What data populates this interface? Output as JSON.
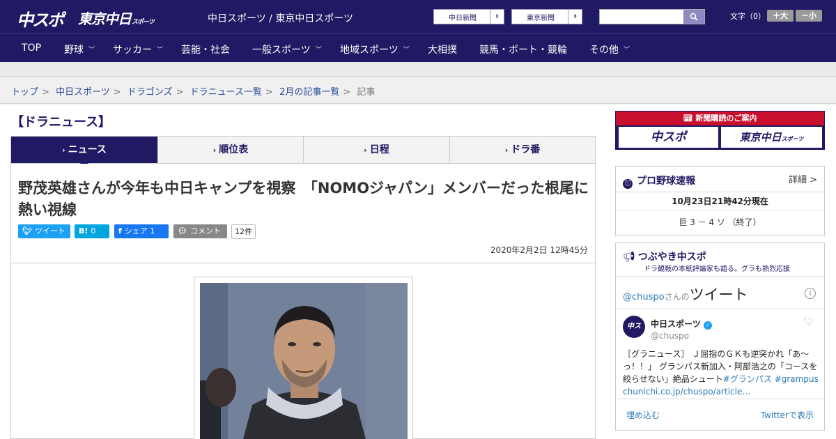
{
  "header": {
    "logo_chuspo": "中スポ",
    "logo_tokyo": "東京中日",
    "logo_tokyo_sub": "スポーツ",
    "site_links": "中日スポーツ / 東京中日スポーツ",
    "paper_buttons": [
      {
        "label": "中日新聞"
      },
      {
        "label": "東京新聞"
      }
    ],
    "search_placeholder": "",
    "font_size_label": "文字（0）",
    "font_bigger": "＋大",
    "font_smaller": "－小"
  },
  "nav": {
    "items": [
      {
        "label": "TOP",
        "dropdown": false
      },
      {
        "label": "野球",
        "dropdown": true
      },
      {
        "label": "サッカー",
        "dropdown": true
      },
      {
        "label": "芸能・社会",
        "dropdown": false
      },
      {
        "label": "一般スポーツ",
        "dropdown": true
      },
      {
        "label": "地域スポーツ",
        "dropdown": true
      },
      {
        "label": "大相撲",
        "dropdown": false
      },
      {
        "label": "競馬・ボート・競輪",
        "dropdown": false
      },
      {
        "label": "その他",
        "dropdown": true
      }
    ]
  },
  "breadcrumb": {
    "items": [
      "トップ",
      "中日スポーツ",
      "ドラゴンズ",
      "ドラニュース一覧",
      "2月の記事一覧"
    ],
    "current": "記事",
    "separator": ">"
  },
  "section_title": "【ドラニュース】",
  "tabs": [
    {
      "label": "ニュース",
      "active": true
    },
    {
      "label": "順位表",
      "active": false
    },
    {
      "label": "日程",
      "active": false
    },
    {
      "label": "ドラ番",
      "active": false
    }
  ],
  "article": {
    "title": "野茂英雄さんが今年も中日キャンプを視察　「NOMOジャパン」メンバーだった根尾に熱い視線",
    "share": {
      "tweet": "ツイート",
      "hatena_icon": "B!",
      "hatena_count": "0",
      "fb_share": "シェア",
      "fb_count": "1",
      "comment": "コメント",
      "comment_count": "12件"
    },
    "date": "2020年2月2日 12時45分"
  },
  "sidebar": {
    "ad": {
      "header": "新聞購読のご案内",
      "chuspo": "中スポ",
      "tokyo": "東京中日",
      "tokyo_sub": "スポーツ"
    },
    "baseball": {
      "title": "プロ野球速報",
      "more": "詳細 >",
      "updated": "10月23日21時42分現在",
      "score": "巨 3 － 4 ソ （終了）"
    },
    "tsubuyaki": {
      "title": "つぶやき中スポ",
      "subtitle": "ドラ観戦の本紙評論家も語る。グラも熱烈応援",
      "handle_link": "@chuspo",
      "handle_suffix": "さんの",
      "tweets_label": "ツイート",
      "tweet": {
        "name": "中日スポーツ",
        "handle": "@chuspo",
        "text": "［グラニュース］ Ｊ屈指のＧＫも逆突かれ「あ～っ！！」 グランパス新加入・阿部浩之の「コースを絞らせない」絶品シュート",
        "tag1": "#グランパス",
        "tag2": "#grampus",
        "link": "chunichi.co.jp/chuspo/article…"
      },
      "embed": "埋め込む",
      "view_on_twitter": "Twitterで表示"
    }
  },
  "colors": {
    "brand": "#1f1a63",
    "twitter": "#1da1f2",
    "hatena": "#00a4de",
    "facebook": "#1877f2",
    "comment": "#888888",
    "ad_red": "#c8102e"
  }
}
